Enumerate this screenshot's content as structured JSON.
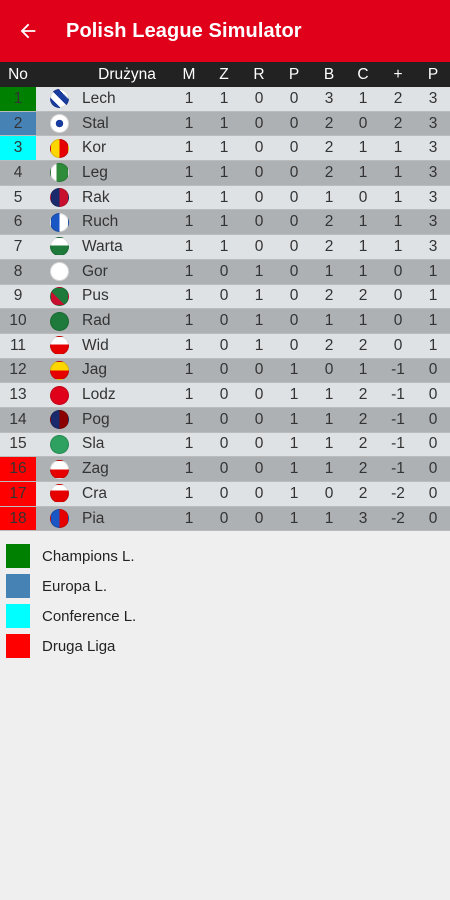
{
  "appbar": {
    "title": "Polish League Simulator",
    "back_icon": "arrow-left-icon",
    "color": "#e0001a"
  },
  "table": {
    "headers": [
      "No",
      "",
      "Drużyna",
      "M",
      "Z",
      "R",
      "P",
      "B",
      "C",
      "+",
      "P"
    ],
    "rows": [
      {
        "no": "1",
        "team": "Lech",
        "m": "1",
        "z": "1",
        "r": "0",
        "p": "0",
        "b": "3",
        "c": "1",
        "diff": "2",
        "pts": "3",
        "zone": "champions",
        "badge": "lech"
      },
      {
        "no": "2",
        "team": "Stal",
        "m": "1",
        "z": "1",
        "r": "0",
        "p": "0",
        "b": "2",
        "c": "0",
        "diff": "2",
        "pts": "3",
        "zone": "europa",
        "badge": "stal"
      },
      {
        "no": "3",
        "team": "Kor",
        "m": "1",
        "z": "1",
        "r": "0",
        "p": "0",
        "b": "2",
        "c": "1",
        "diff": "1",
        "pts": "3",
        "zone": "conference",
        "badge": "kor"
      },
      {
        "no": "4",
        "team": "Leg",
        "m": "1",
        "z": "1",
        "r": "0",
        "p": "0",
        "b": "2",
        "c": "1",
        "diff": "1",
        "pts": "3",
        "zone": "",
        "badge": "leg"
      },
      {
        "no": "5",
        "team": "Rak",
        "m": "1",
        "z": "1",
        "r": "0",
        "p": "0",
        "b": "1",
        "c": "0",
        "diff": "1",
        "pts": "3",
        "zone": "",
        "badge": "rak"
      },
      {
        "no": "6",
        "team": "Ruch",
        "m": "1",
        "z": "1",
        "r": "0",
        "p": "0",
        "b": "2",
        "c": "1",
        "diff": "1",
        "pts": "3",
        "zone": "",
        "badge": "ruch"
      },
      {
        "no": "7",
        "team": "Warta",
        "m": "1",
        "z": "1",
        "r": "0",
        "p": "0",
        "b": "2",
        "c": "1",
        "diff": "1",
        "pts": "3",
        "zone": "",
        "badge": "warta"
      },
      {
        "no": "8",
        "team": "Gor",
        "m": "1",
        "z": "0",
        "r": "1",
        "p": "0",
        "b": "1",
        "c": "1",
        "diff": "0",
        "pts": "1",
        "zone": "",
        "badge": "gor"
      },
      {
        "no": "9",
        "team": "Pus",
        "m": "1",
        "z": "0",
        "r": "1",
        "p": "0",
        "b": "2",
        "c": "2",
        "diff": "0",
        "pts": "1",
        "zone": "",
        "badge": "pus"
      },
      {
        "no": "10",
        "team": "Rad",
        "m": "1",
        "z": "0",
        "r": "1",
        "p": "0",
        "b": "1",
        "c": "1",
        "diff": "0",
        "pts": "1",
        "zone": "",
        "badge": "rad"
      },
      {
        "no": "11",
        "team": "Wid",
        "m": "1",
        "z": "0",
        "r": "1",
        "p": "0",
        "b": "2",
        "c": "2",
        "diff": "0",
        "pts": "1",
        "zone": "",
        "badge": "wid"
      },
      {
        "no": "12",
        "team": "Jag",
        "m": "1",
        "z": "0",
        "r": "0",
        "p": "1",
        "b": "0",
        "c": "1",
        "diff": "-1",
        "pts": "0",
        "zone": "",
        "badge": "jag"
      },
      {
        "no": "13",
        "team": "Lodz",
        "m": "1",
        "z": "0",
        "r": "0",
        "p": "1",
        "b": "1",
        "c": "2",
        "diff": "-1",
        "pts": "0",
        "zone": "",
        "badge": "lodz"
      },
      {
        "no": "14",
        "team": "Pog",
        "m": "1",
        "z": "0",
        "r": "0",
        "p": "1",
        "b": "1",
        "c": "2",
        "diff": "-1",
        "pts": "0",
        "zone": "",
        "badge": "pog"
      },
      {
        "no": "15",
        "team": "Sla",
        "m": "1",
        "z": "0",
        "r": "0",
        "p": "1",
        "b": "1",
        "c": "2",
        "diff": "-1",
        "pts": "0",
        "zone": "",
        "badge": "sla"
      },
      {
        "no": "16",
        "team": "Zag",
        "m": "1",
        "z": "0",
        "r": "0",
        "p": "1",
        "b": "1",
        "c": "2",
        "diff": "-1",
        "pts": "0",
        "zone": "druga",
        "badge": "zag"
      },
      {
        "no": "17",
        "team": "Cra",
        "m": "1",
        "z": "0",
        "r": "0",
        "p": "1",
        "b": "0",
        "c": "2",
        "diff": "-2",
        "pts": "0",
        "zone": "druga",
        "badge": "cra"
      },
      {
        "no": "18",
        "team": "Pia",
        "m": "1",
        "z": "0",
        "r": "0",
        "p": "1",
        "b": "1",
        "c": "3",
        "diff": "-2",
        "pts": "0",
        "zone": "druga",
        "badge": "pia"
      }
    ]
  },
  "zones": {
    "champions": {
      "label": "Champions L.",
      "color": "#008000"
    },
    "europa": {
      "label": "Europa L.",
      "color": "#4682b4"
    },
    "conference": {
      "label": "Conference L.",
      "color": "#00ffff"
    },
    "druga": {
      "label": "Druga Liga",
      "color": "#ff0000"
    }
  },
  "legend": [
    {
      "label": "Champions L.",
      "color": "#008000"
    },
    {
      "label": "Europa L.",
      "color": "#4682b4"
    },
    {
      "label": "Conference L.",
      "color": "#00ffff"
    },
    {
      "label": "Druga Liga",
      "color": "#ff0000"
    }
  ],
  "badges": {
    "lech": "linear-gradient(45deg,#1a3c9e 25%,#fff 25%,#fff 50%,#1a3c9e 50%,#1a3c9e 75%,#fff 75%)",
    "stal": "radial-gradient(circle,#1a3c9e 30%,#fff 32%)",
    "kor": "linear-gradient(90deg,#ffd700 50%,#e60000 50%)",
    "leg": "linear-gradient(90deg,#fff 33%,#2e8b3a 33%)",
    "rak": "linear-gradient(90deg,#1a2a6c 50%,#c8102e 50%)",
    "ruch": "linear-gradient(90deg,#1a56c4 50%,#fff 50%)",
    "warta": "linear-gradient(180deg,#fff 45%,#1e7a3a 45%)",
    "gor": "radial-gradient(circle,#fff 60%,#fff 61%)",
    "pus": "linear-gradient(45deg,#c8102e 40%,#1e7a3a 40%)",
    "rad": "radial-gradient(circle,#1e7a3a 60%,#1e7a3a 61%)",
    "wid": "linear-gradient(180deg,#fff 45%,#e60000 45%)",
    "jag": "linear-gradient(180deg,#ffd700 50%,#e60000 50%)",
    "lodz": "radial-gradient(circle,#e0001a 60%,#e0001a 61%)",
    "pog": "linear-gradient(90deg,#1a2a6c 50%,#8b0000 50%)",
    "sla": "radial-gradient(circle,#2ea060 60%,#2ea060 61%)",
    "zag": "linear-gradient(180deg,#fff 50%,#e60000 50%)",
    "cra": "linear-gradient(180deg,#fff 33%,#e60000 33%)",
    "pia": "linear-gradient(90deg,#1a56c4 50%,#e60000 50%)"
  }
}
